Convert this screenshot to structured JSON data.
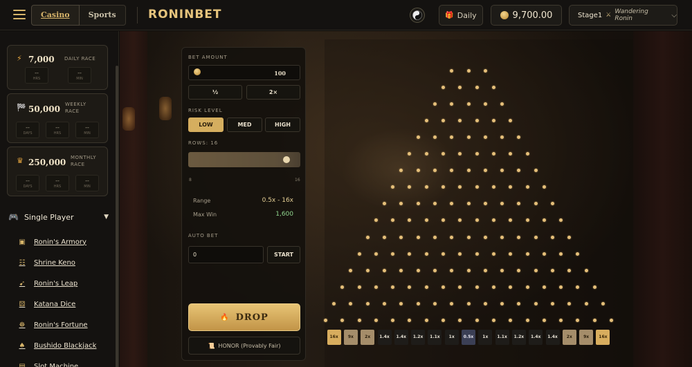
{
  "topbar": {
    "tabs": [
      {
        "label": "Casino"
      },
      {
        "label": "Sports"
      }
    ],
    "logo": "RONINBET",
    "daily_label": "Daily",
    "balance": "9,700.00",
    "stage": {
      "level": "Stage1",
      "name": "Wandering Ronin"
    }
  },
  "races": [
    {
      "amount": "7,000",
      "label": "DAILY RACE",
      "icon": "lightning-icon",
      "timers": [
        {
          "value": "--",
          "unit": "HRS"
        },
        {
          "value": "--",
          "unit": "MIN"
        }
      ]
    },
    {
      "amount": "50,000",
      "label": "WEEKLY RACE",
      "icon": "checkered-flag-icon",
      "timers": [
        {
          "value": "--",
          "unit": "DAYS"
        },
        {
          "value": "--",
          "unit": "HRS"
        },
        {
          "value": "--",
          "unit": "MIN"
        }
      ]
    },
    {
      "amount": "250,000",
      "label": "MONTHLY RACE",
      "icon": "crown-icon",
      "timers": [
        {
          "value": "--",
          "unit": "DAYS"
        },
        {
          "value": "--",
          "unit": "HRS"
        },
        {
          "value": "--",
          "unit": "MIN"
        }
      ]
    }
  ],
  "sidebar": {
    "section_label": "Single Player",
    "games": [
      {
        "label": "Ronin's Armory",
        "icon": "chest-icon"
      },
      {
        "label": "Shrine Keno",
        "icon": "grid-icon"
      },
      {
        "label": "Ronin's Leap",
        "icon": "rocket-icon"
      },
      {
        "label": "Katana Dice",
        "icon": "dice-icon"
      },
      {
        "label": "Ronin's Fortune",
        "icon": "wheel-icon"
      },
      {
        "label": "Bushido Blackjack",
        "icon": "cards-icon"
      },
      {
        "label": "Slot Machine",
        "icon": "slot-icon"
      }
    ]
  },
  "panel": {
    "bet_label": "BET AMOUNT",
    "bet_value": "100",
    "half_label": "½",
    "double_label": "2×",
    "risk_label": "RISK LEVEL",
    "risk_options": [
      "LOW",
      "MED",
      "HIGH"
    ],
    "risk_selected": "LOW",
    "rows_label": "ROWS: 16",
    "rows_value": 16,
    "rows_min": "8",
    "rows_max": "16",
    "range_label": "Range",
    "range_value": "0.5x - 16x",
    "maxwin_label": "Max Win",
    "maxwin_value": "1,600",
    "autobet_label": "AUTO BET",
    "autobet_value": "0",
    "start_label": "START",
    "drop_label": "DROP",
    "honor_label": "HONOR (Provably Fair)"
  },
  "board": {
    "rows": 16,
    "multipliers": [
      "16x",
      "9x",
      "2x",
      "1.4x",
      "1.4x",
      "1.2x",
      "1.1x",
      "1x",
      "0.5x",
      "1x",
      "1.1x",
      "1.2x",
      "1.4x",
      "1.4x",
      "2x",
      "9x",
      "16x"
    ],
    "colors": {
      "peg": "#e6c07a",
      "gold": "#d8ad5e",
      "tan": "#a58d6a",
      "dark": "#1e1c19",
      "blue": "#3b3f55"
    }
  }
}
